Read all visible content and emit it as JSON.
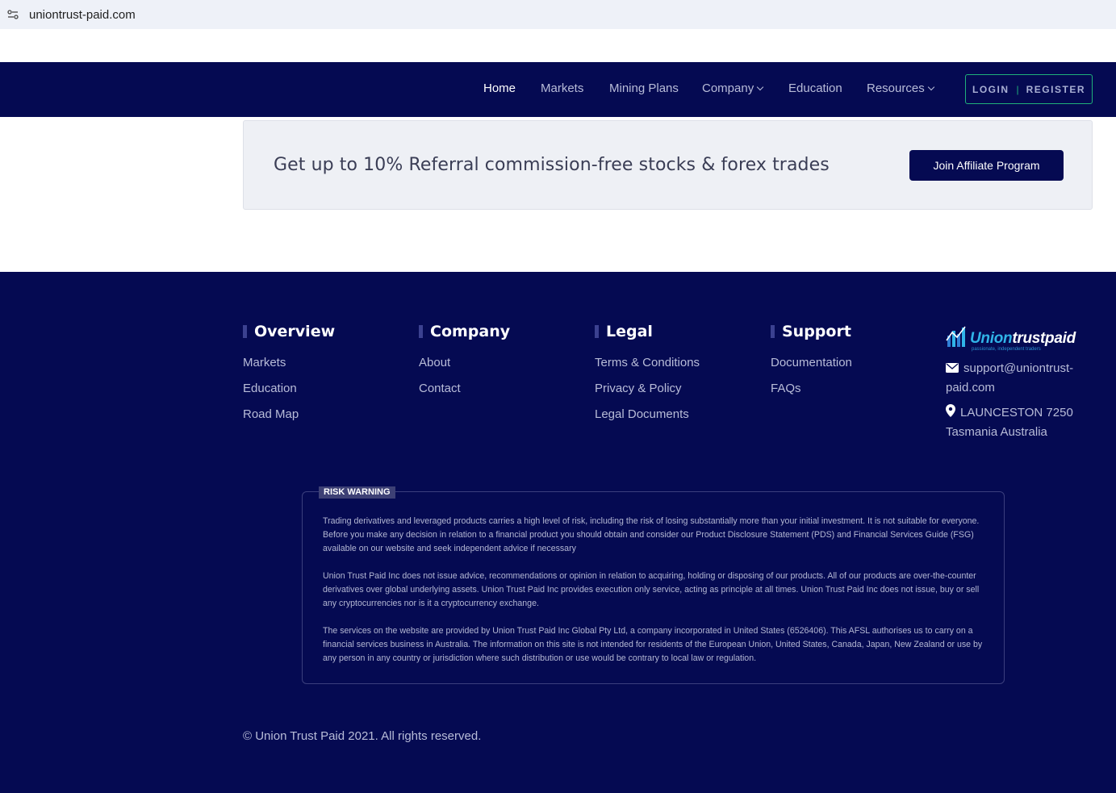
{
  "browser": {
    "url": "uniontrust-paid.com"
  },
  "nav": {
    "items": [
      {
        "label": "Home"
      },
      {
        "label": "Markets"
      },
      {
        "label": "Mining Plans"
      },
      {
        "label": "Company"
      },
      {
        "label": "Education"
      },
      {
        "label": "Resources"
      }
    ],
    "login": "LOGIN",
    "separator": "|",
    "register": "REGISTER"
  },
  "promo": {
    "text": "Get up to 10% Referral commission-free stocks & forex trades",
    "button": "Join Affiliate Program"
  },
  "footer": {
    "columns": [
      {
        "title": "Overview",
        "links": [
          "Markets",
          "Education",
          "Road Map"
        ]
      },
      {
        "title": "Company",
        "links": [
          "About",
          "Contact"
        ]
      },
      {
        "title": "Legal",
        "links": [
          "Terms & Conditions",
          "Privacy & Policy",
          "Legal Documents"
        ]
      },
      {
        "title": "Support",
        "links": [
          "Documentation",
          "FAQs"
        ]
      }
    ],
    "brand": {
      "name_part1": "Union",
      "name_part2": "trustpaid",
      "tagline": "passionate, independent traders"
    },
    "email_line1": "support@uniontrust-",
    "email_line2": "paid.com",
    "address_line1": "LAUNCESTON 7250",
    "address_line2": "Tasmania Australia",
    "risk": {
      "label": "RISK WARNING",
      "p1": "Trading derivatives and leveraged products carries a high level of risk, including the risk of losing substantially more than your initial investment. It is not suitable for everyone. Before you make any decision in relation to a financial product you should obtain and consider our Product Disclosure Statement (PDS) and Financial Services Guide (FSG) available on our website and seek independent advice if necessary",
      "p2": "Union Trust Paid Inc does not issue advice, recommendations or opinion in relation to acquiring, holding or disposing of our products. All of our products are over-the-counter derivatives over global underlying assets. Union Trust Paid Inc provides execution only service, acting as principle at all times. Union Trust Paid Inc does not issue, buy or sell any cryptocurrencies nor is it a cryptocurrency exchange.",
      "p3": "The services on the website are provided by Union Trust Paid Inc Global Pty Ltd, a company incorporated in United States (6526406). This AFSL authorises us to carry on a financial services business in Australia. The information on this site is not intended for residents of the European Union, United States, Canada, Japan, New Zealand or use by any person in any country or jurisdiction where such distribution or use would be contrary to local law or regulation."
    },
    "copyright": "© Union Trust Paid 2021. All rights reserved."
  }
}
